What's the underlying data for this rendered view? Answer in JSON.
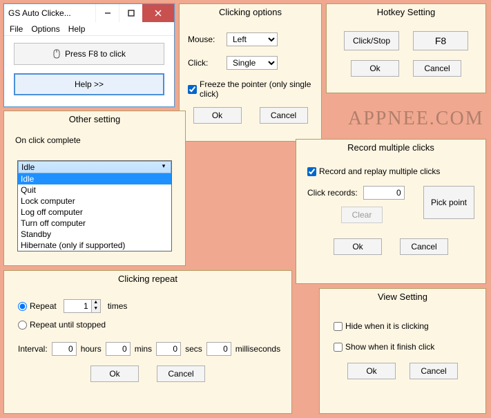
{
  "app": {
    "title": "GS Auto Clicke...",
    "menu": {
      "file": "File",
      "options": "Options",
      "help": "Help"
    },
    "press_label": "Press F8 to click",
    "help_label": "Help >>"
  },
  "clicking_options": {
    "title": "Clicking options",
    "mouse_label": "Mouse:",
    "mouse_value": "Left",
    "click_label": "Click:",
    "click_value": "Single",
    "freeze_label": "Freeze the pointer (only single click)",
    "freeze_checked": true,
    "ok": "Ok",
    "cancel": "Cancel"
  },
  "hotkey": {
    "title": "Hotkey Setting",
    "clickstop": "Click/Stop",
    "key": "F8",
    "ok": "Ok",
    "cancel": "Cancel"
  },
  "other": {
    "title": "Other setting",
    "on_click_label": "On click complete",
    "selected": "Idle",
    "options": [
      "Idle",
      "Quit",
      "Lock computer",
      "Log off computer",
      "Turn off computer",
      "Standby",
      "Hibernate (only if supported)"
    ]
  },
  "record": {
    "title": "Record multiple clicks",
    "enable_label": "Record and replay multiple clicks",
    "enable_checked": true,
    "records_label": "Click records:",
    "records_value": "0",
    "clear": "Clear",
    "pick": "Pick point",
    "ok": "Ok",
    "cancel": "Cancel"
  },
  "repeat": {
    "title": "Clicking repeat",
    "repeat_label": "Repeat",
    "repeat_times": "1",
    "times_label": "times",
    "until_label": "Repeat until stopped",
    "interval_label": "Interval:",
    "hours": "0",
    "mins": "0",
    "secs": "0",
    "ms": "0",
    "hours_l": "hours",
    "mins_l": "mins",
    "secs_l": "secs",
    "ms_l": "milliseconds",
    "ok": "Ok",
    "cancel": "Cancel"
  },
  "view": {
    "title": "View Setting",
    "hide_label": "Hide when it is clicking",
    "show_label": "Show when it finish click",
    "ok": "Ok",
    "cancel": "Cancel"
  },
  "watermark": "APPNEE.COM"
}
